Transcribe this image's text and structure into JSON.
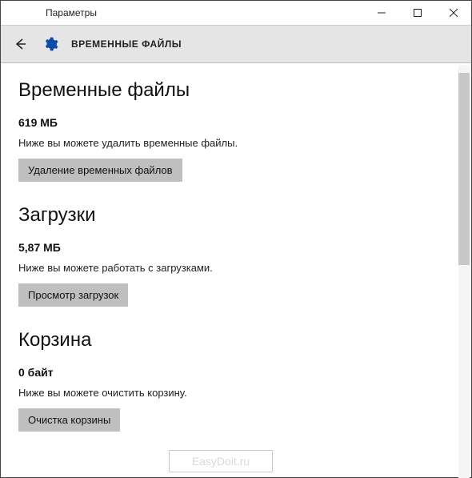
{
  "window": {
    "title": "Параметры"
  },
  "header": {
    "title": "ВРЕМЕННЫЕ ФАЙЛЫ"
  },
  "sections": {
    "temp": {
      "title": "Временные файлы",
      "size": "619 МБ",
      "desc": "Ниже вы можете удалить временные файлы.",
      "button": "Удаление временных файлов"
    },
    "downloads": {
      "title": "Загрузки",
      "size": "5,87 МБ",
      "desc": "Ниже вы можете работать с загрузками.",
      "button": "Просмотр загрузок"
    },
    "recycle": {
      "title": "Корзина",
      "size": "0 байт",
      "desc": "Ниже вы можете очистить корзину.",
      "button": "Очистка корзины"
    }
  },
  "watermark": "EasyDoit.ru"
}
